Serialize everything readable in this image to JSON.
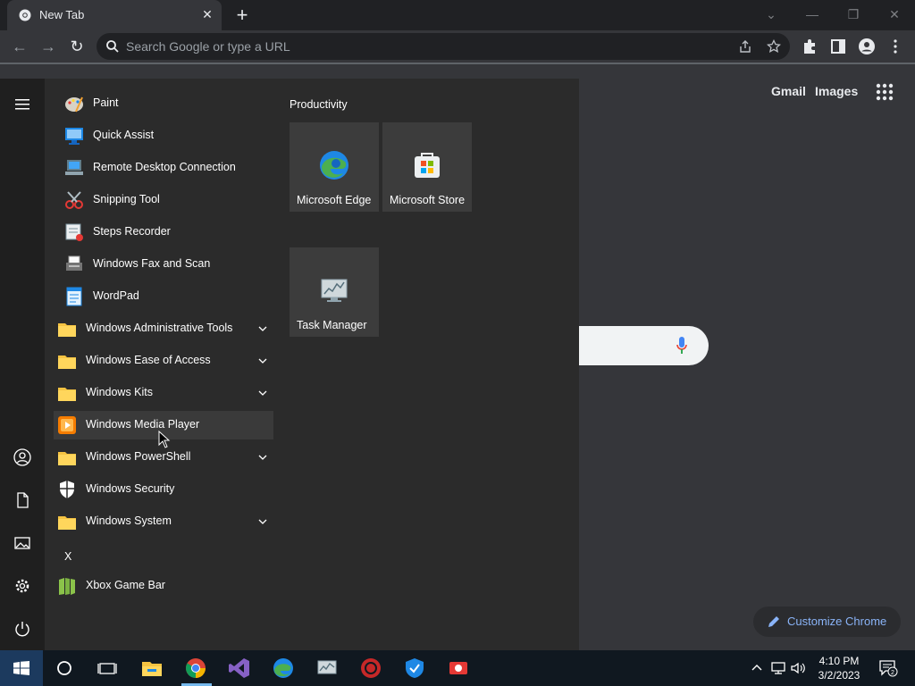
{
  "browser": {
    "tab_title": "New Tab",
    "omnibox_placeholder": "Search Google or type a URL"
  },
  "ntp": {
    "gmail": "Gmail",
    "images": "Images",
    "customize": "Customize Chrome"
  },
  "start_menu": {
    "apps": [
      {
        "label": "Paint",
        "icon": "paint-icon"
      },
      {
        "label": "Quick Assist",
        "icon": "quick-assist-icon"
      },
      {
        "label": "Remote Desktop Connection",
        "icon": "remote-desktop-icon"
      },
      {
        "label": "Snipping Tool",
        "icon": "snipping-tool-icon"
      },
      {
        "label": "Steps Recorder",
        "icon": "steps-recorder-icon"
      },
      {
        "label": "Windows Fax and Scan",
        "icon": "fax-scan-icon"
      },
      {
        "label": "WordPad",
        "icon": "wordpad-icon"
      },
      {
        "label": "Windows Administrative Tools",
        "icon": "folder-icon"
      },
      {
        "label": "Windows Ease of Access",
        "icon": "folder-icon"
      },
      {
        "label": "Windows Kits",
        "icon": "folder-icon"
      },
      {
        "label": "Windows Media Player",
        "icon": "media-player-icon"
      },
      {
        "label": "Windows PowerShell",
        "icon": "folder-icon"
      },
      {
        "label": "Windows Security",
        "icon": "shield-icon"
      },
      {
        "label": "Windows System",
        "icon": "folder-icon"
      },
      {
        "label": "Xbox Game Bar",
        "icon": "xbox-game-bar-icon"
      }
    ],
    "letter_x": "X",
    "group_title": "Productivity",
    "tiles": [
      {
        "label": "Microsoft Edge",
        "icon": "edge-icon"
      },
      {
        "label": "Microsoft Store",
        "icon": "store-icon"
      },
      {
        "label": "Task Manager",
        "icon": "task-manager-icon"
      }
    ]
  },
  "taskbar": {
    "time": "4:10 PM",
    "date": "3/2/2023",
    "notification_count": "2"
  },
  "colors": {
    "accent": "#76b9ed",
    "link": "#8ab4f8",
    "folder": "#f5c342"
  }
}
